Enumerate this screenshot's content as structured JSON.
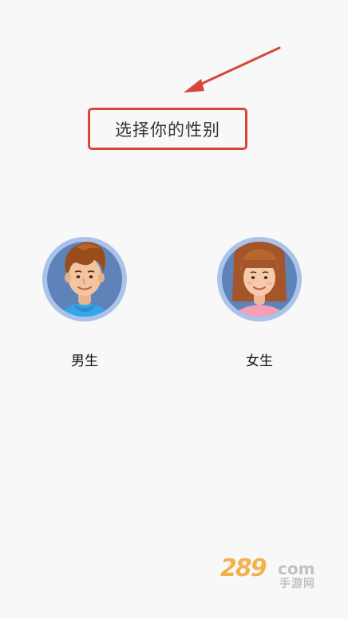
{
  "title": "选择你的性别",
  "options": [
    {
      "id": "male",
      "label": "男生",
      "icon": "male-avatar-icon"
    },
    {
      "id": "female",
      "label": "女生",
      "icon": "female-avatar-icon"
    }
  ],
  "watermark": {
    "number": "289",
    "suffix": "com",
    "sub": "手游网"
  },
  "colors": {
    "annotation": "#d9473a",
    "background": "#f8f8f8",
    "avatar_ring": "#a9c3ea",
    "avatar_bg": "#5e83b8"
  }
}
